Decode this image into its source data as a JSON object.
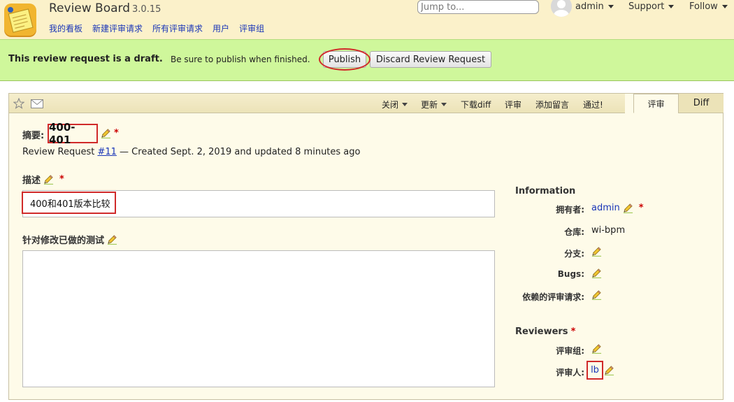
{
  "app": {
    "title": "Review Board",
    "version": "3.0.15"
  },
  "nav": [
    "我的看板",
    "新建评审请求",
    "所有评审请求",
    "用户",
    "评审组"
  ],
  "search": {
    "placeholder": "Jump to..."
  },
  "user_menu": {
    "user": "admin",
    "support": "Support",
    "follow": "Follow"
  },
  "banner": {
    "strong": "This review request is a draft.",
    "message": "Be sure to publish when finished.",
    "publish": "Publish",
    "discard": "Discard Review Request"
  },
  "toolbar": {
    "close": "关闭",
    "update": "更新",
    "download_diff": "下载diff",
    "review": "评审",
    "add_comment": "添加留言",
    "ship_it": "通过!"
  },
  "tabs": {
    "review": "评审",
    "diff": "Diff"
  },
  "summary": {
    "label": "摘要:",
    "value": "400-401",
    "required": "*"
  },
  "meta": {
    "prefix": "Review Request",
    "id_link": "#11",
    "suffix": "— Created Sept. 2, 2019 and updated 8 minutes ago"
  },
  "description": {
    "label": "描述",
    "required": "*",
    "value": "400和401版本比较"
  },
  "testing": {
    "label": "针对修改已做的测试",
    "value": ""
  },
  "information": {
    "title": "Information",
    "owner_label": "拥有者:",
    "owner": "admin",
    "owner_required": "*",
    "repo_label": "仓库:",
    "repo": "wi-bpm",
    "branch_label": "分支:",
    "bugs_label": "Bugs:",
    "depends_label": "依赖的评审请求:"
  },
  "reviewers": {
    "title": "Reviewers",
    "required": "*",
    "groups_label": "评审组:",
    "people_label": "评审人:",
    "people": "lb"
  },
  "colors": {
    "header_bg": "#fbf1ca",
    "banner_bg": "#cff79b",
    "highlight": "#d02a2a",
    "link": "#1a36b8"
  }
}
